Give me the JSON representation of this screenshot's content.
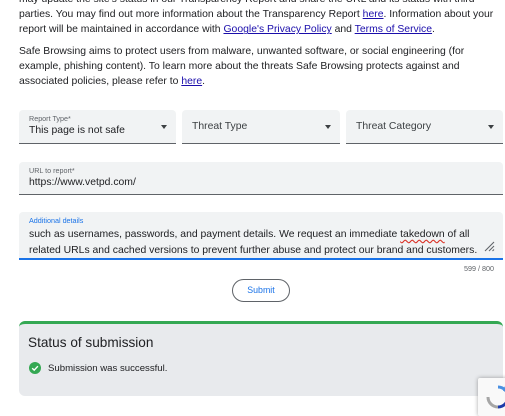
{
  "intro": {
    "line1": "may update the site's status in our Transparency Report and share the URL and its status with third parties. You",
    "line2_a": "may find out more information about the Transparency Report ",
    "link_here1": "here",
    "line2_b": ". Information about your report will be",
    "line3_a": "maintained in accordance with ",
    "link_privacy": "Google's Privacy Policy",
    "line3_and": " and ",
    "link_terms": "Terms of Service",
    "line3_end": ".",
    "p2_a": "Safe Browsing aims to protect users from malware, unwanted software, or social engineering (for example, phishing content). To learn more about the threats Safe Browsing protects against and associated policies, please refer to ",
    "link_here2": "here",
    "p2_end": "."
  },
  "report_type": {
    "label": "Report Type*",
    "value": "This page is not safe"
  },
  "threat_type": {
    "value": "Threat Type"
  },
  "threat_category": {
    "value": "Threat Category"
  },
  "url_field": {
    "label": "URL to report*",
    "value": "https://www.vetpd.com/"
  },
  "details_field": {
    "label": "Additional details",
    "text_a": "such as usernames, passwords, and payment details. We request an immediate ",
    "text_misspelled": "takedown",
    "text_b": " of all related URLs and cached versions to prevent further abuse and protect our brand and customers."
  },
  "char_counter": "599 / 800",
  "submit_label": "Submit",
  "status": {
    "title": "Status of submission",
    "message": "Submission was successful."
  },
  "colors": {
    "accent": "#1a73e8",
    "success": "#34a853",
    "link": "#1a0dab",
    "field_bg": "#f1f3f4"
  },
  "icons": [
    "dropdown-arrow-icon",
    "resize-handle-icon",
    "check-circle-icon",
    "recaptcha-icon"
  ]
}
